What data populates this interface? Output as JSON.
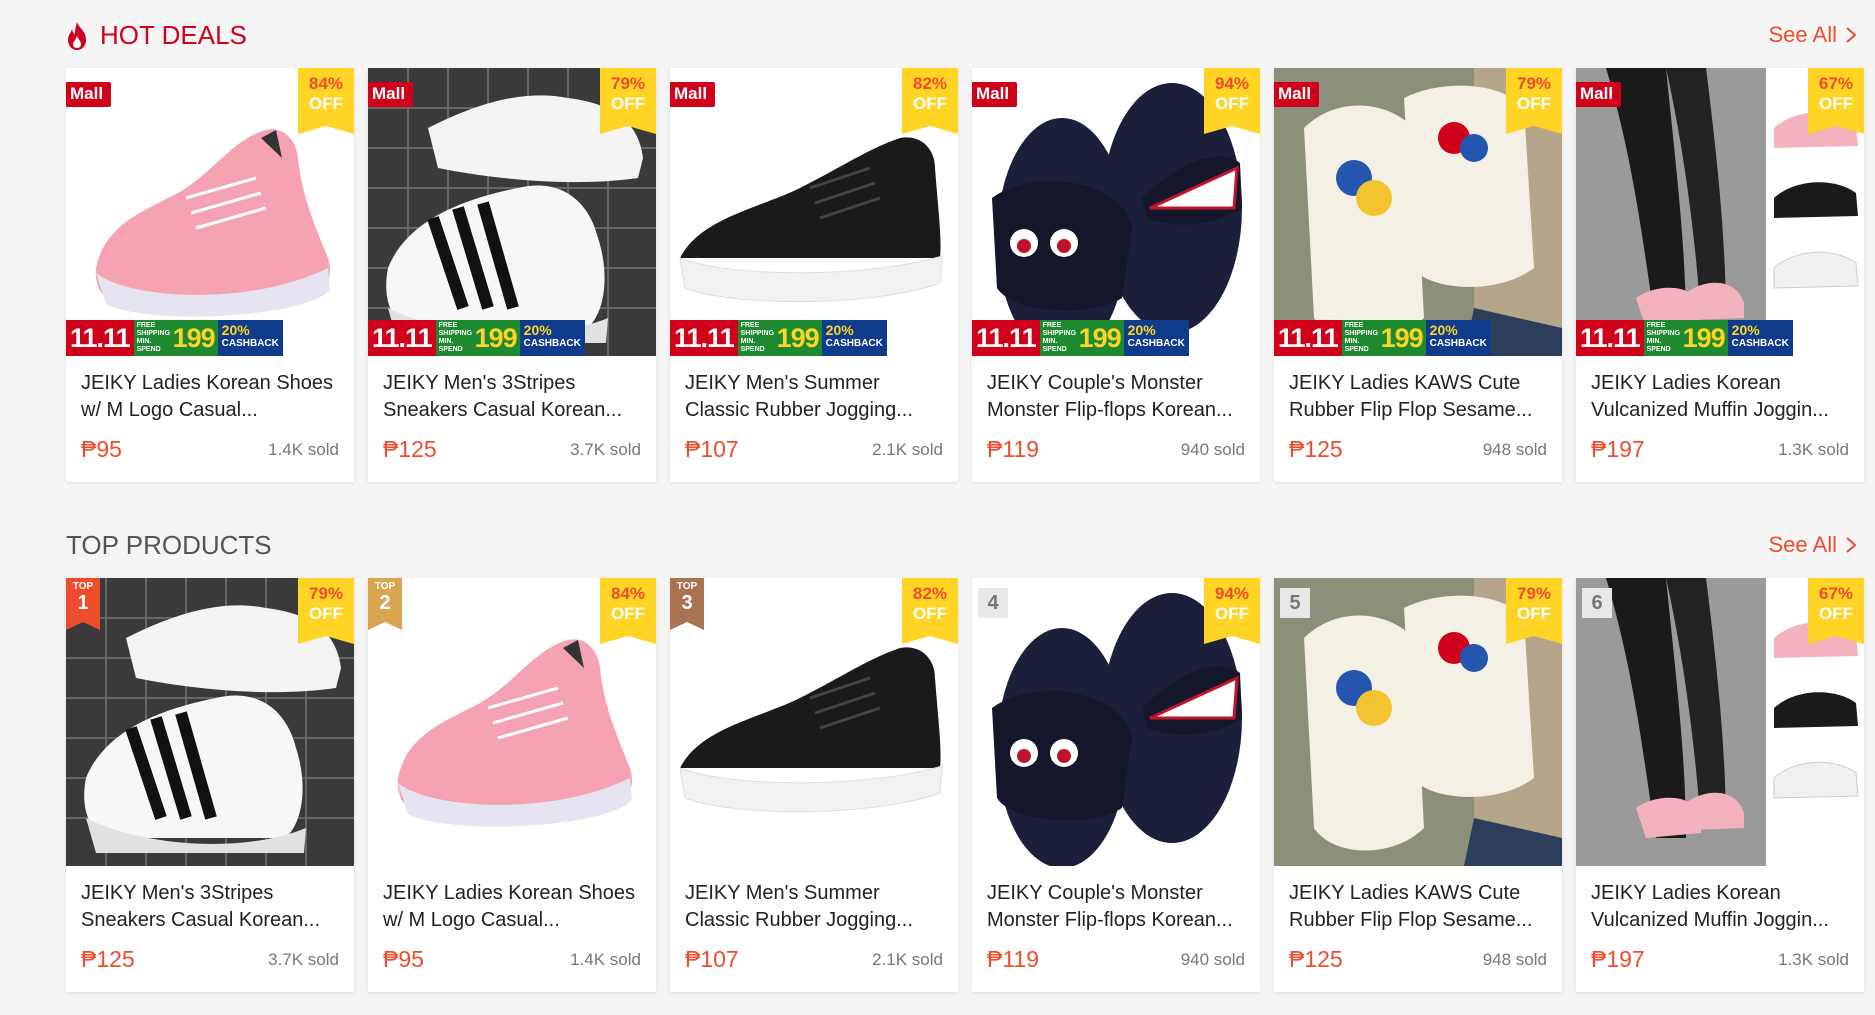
{
  "hot_deals": {
    "title": "HOT DEALS",
    "see_all": "See All",
    "items": [
      {
        "name": "JEIKY Ladies Korean Shoes w/ M Logo Casual...",
        "price": "₱95",
        "sold": "1.4K sold",
        "discount": "84%",
        "off": "OFF",
        "badge": "Mall",
        "art": "pink-sneaker"
      },
      {
        "name": "JEIKY Men's 3Stripes Sneakers Casual Korean...",
        "price": "₱125",
        "sold": "3.7K sold",
        "discount": "79%",
        "off": "OFF",
        "badge": "Mall",
        "art": "white-stripes"
      },
      {
        "name": "JEIKY Men's Summer Classic Rubber Jogging...",
        "price": "₱107",
        "sold": "2.1K sold",
        "discount": "82%",
        "off": "OFF",
        "badge": "Mall",
        "art": "black-sneaker"
      },
      {
        "name": "JEIKY Couple's Monster Monster Flip-flops Korean...",
        "price": "₱119",
        "sold": "940 sold",
        "discount": "94%",
        "off": "OFF",
        "badge": "Mall",
        "art": "monster-slides"
      },
      {
        "name": "JEIKY Ladies KAWS Cute Rubber Flip Flop Sesame...",
        "price": "₱125",
        "sold": "948 sold",
        "discount": "79%",
        "off": "OFF",
        "badge": "Mall",
        "art": "kaws-slides"
      },
      {
        "name": "JEIKY Ladies Korean Vulcanized Muffin Joggin...",
        "price": "₱197",
        "sold": "1.3K sold",
        "discount": "67%",
        "off": "OFF",
        "badge": "Mall",
        "art": "muffin-shoes"
      }
    ]
  },
  "promo": {
    "date": "11.11",
    "line1": "FREE",
    "line2": "SHIPPING",
    "line3": "MIN. SPEND",
    "amount": "199",
    "percent": "20%",
    "cashback": "CASHBACK"
  },
  "top_products": {
    "title": "TOP PRODUCTS",
    "see_all": "See All",
    "top_label": "TOP",
    "items": [
      {
        "rank": "1",
        "name": "JEIKY Men's 3Stripes Sneakers Casual Korean...",
        "price": "₱125",
        "sold": "3.7K sold",
        "discount": "79%",
        "off": "OFF",
        "art": "white-stripes"
      },
      {
        "rank": "2",
        "name": "JEIKY Ladies Korean Shoes w/ M Logo Casual...",
        "price": "₱95",
        "sold": "1.4K sold",
        "discount": "84%",
        "off": "OFF",
        "art": "pink-sneaker"
      },
      {
        "rank": "3",
        "name": "JEIKY Men's Summer Classic Rubber Jogging...",
        "price": "₱107",
        "sold": "2.1K sold",
        "discount": "82%",
        "off": "OFF",
        "art": "black-sneaker"
      },
      {
        "rank": "4",
        "name": "JEIKY Couple's Monster Monster Flip-flops Korean...",
        "price": "₱119",
        "sold": "940 sold",
        "discount": "94%",
        "off": "OFF",
        "art": "monster-slides"
      },
      {
        "rank": "5",
        "name": "JEIKY Ladies KAWS Cute Rubber Flip Flop Sesame...",
        "price": "₱125",
        "sold": "948 sold",
        "discount": "79%",
        "off": "OFF",
        "art": "kaws-slides"
      },
      {
        "rank": "6",
        "name": "JEIKY Ladies Korean Vulcanized Muffin Joggin...",
        "price": "₱197",
        "sold": "1.3K sold",
        "discount": "67%",
        "off": "OFF",
        "art": "muffin-shoes"
      }
    ]
  },
  "colors": {
    "brand": "#ee4d2d",
    "mall": "#d0011b",
    "discount_bg": "#ffd424"
  }
}
